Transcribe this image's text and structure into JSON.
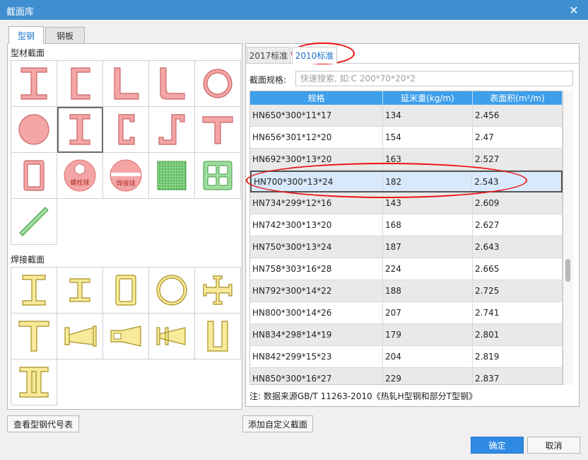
{
  "window": {
    "title": "截面库",
    "close_glyph": "✕"
  },
  "tabs": [
    {
      "label": "型钢",
      "active": true
    },
    {
      "label": "钢板",
      "active": false
    }
  ],
  "left": {
    "profile_section_label": "型材截面",
    "weld_section_label": "焊接截面",
    "bolt_ball_label": "螺栓球",
    "weld_ball_label": "焊接球"
  },
  "subtabs": [
    {
      "label": "2017标准",
      "active": false
    },
    {
      "label": "2010标准",
      "active": true
    }
  ],
  "search": {
    "label": "截面规格:",
    "placeholder": "快速搜索, 如:C 200*70*20*2",
    "value": ""
  },
  "table": {
    "headers": [
      "规格",
      "延米重(kg/m)",
      "表面积(m²/m)"
    ],
    "rows": [
      [
        "HN650*300*11*17",
        "134",
        "2.456"
      ],
      [
        "HN656*301*12*20",
        "154",
        "2.47"
      ],
      [
        "HN692*300*13*20",
        "163",
        "2.527"
      ],
      [
        "HN700*300*13*24",
        "182",
        "2.543"
      ],
      [
        "HN734*299*12*16",
        "143",
        "2.609"
      ],
      [
        "HN742*300*13*20",
        "168",
        "2.627"
      ],
      [
        "HN750*300*13*24",
        "187",
        "2.643"
      ],
      [
        "HN758*303*16*28",
        "224",
        "2.665"
      ],
      [
        "HN792*300*14*22",
        "188",
        "2.725"
      ],
      [
        "HN800*300*14*26",
        "207",
        "2.741"
      ],
      [
        "HN834*298*14*19",
        "179",
        "2.801"
      ],
      [
        "HN842*299*15*23",
        "204",
        "2.819"
      ],
      [
        "HN850*300*16*27",
        "229",
        "2.837"
      ]
    ],
    "selected_index": 3
  },
  "note": "注: 数据来源GB/T 11263-2010《热轧H型钢和部分T型钢》",
  "buttons": {
    "view_codes": "查看型钢代号表",
    "add_custom": "添加自定义截面",
    "ok": "确定",
    "cancel": "取消"
  },
  "colors": {
    "accent": "#2f8ae4",
    "header": "#3e9fea",
    "profile_fill": "#f4a5a5",
    "weld_fill": "#f7ea9a",
    "plate_fill": "#9fdc9f",
    "annotation": "#e11111"
  }
}
